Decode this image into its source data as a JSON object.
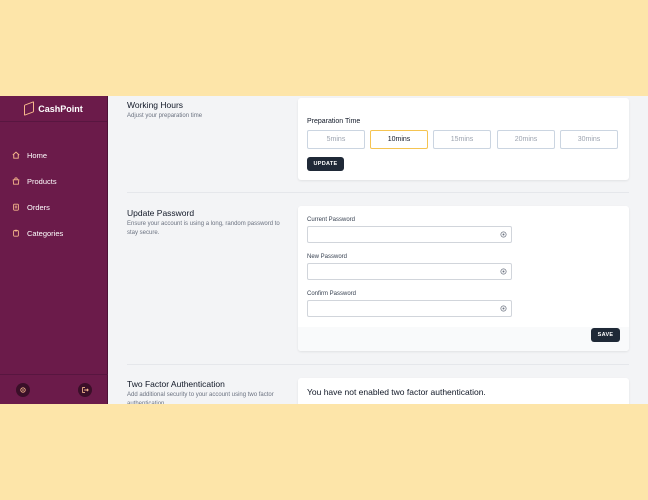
{
  "brand": {
    "name": "CashPoint"
  },
  "nav": [
    {
      "label": "Home",
      "icon": "home-icon"
    },
    {
      "label": "Products",
      "icon": "bag-icon"
    },
    {
      "label": "Orders",
      "icon": "orders-icon"
    },
    {
      "label": "Categories",
      "icon": "clipboard-icon"
    }
  ],
  "footer": {
    "settings_icon": "gear-icon",
    "logout_icon": "logout-icon"
  },
  "working_hours": {
    "title": "Working Hours",
    "description": "Adjust your preparation time",
    "prep_label": "Preparation Time",
    "options": [
      "5mins",
      "10mins",
      "15mins",
      "20mins",
      "30mins"
    ],
    "selected": "10mins",
    "update_button": "UPDATE"
  },
  "update_password": {
    "title": "Update Password",
    "description": "Ensure your account is using a long, random password to stay secure.",
    "fields": [
      {
        "label": "Current Password",
        "value": ""
      },
      {
        "label": "New Password",
        "value": ""
      },
      {
        "label": "Confirm Password",
        "value": ""
      }
    ],
    "save_button": "SAVE"
  },
  "two_factor": {
    "title": "Two Factor Authentication",
    "description": "Add additional security to your account using two factor authentication.",
    "status": "You have not enabled two factor authentication."
  },
  "colors": {
    "page_background": "#fde5a9",
    "sidebar": "#6b1b4a",
    "accent_icon": "#f6b78c",
    "selected_border": "#f5c451",
    "button_dark": "#1f2937"
  }
}
